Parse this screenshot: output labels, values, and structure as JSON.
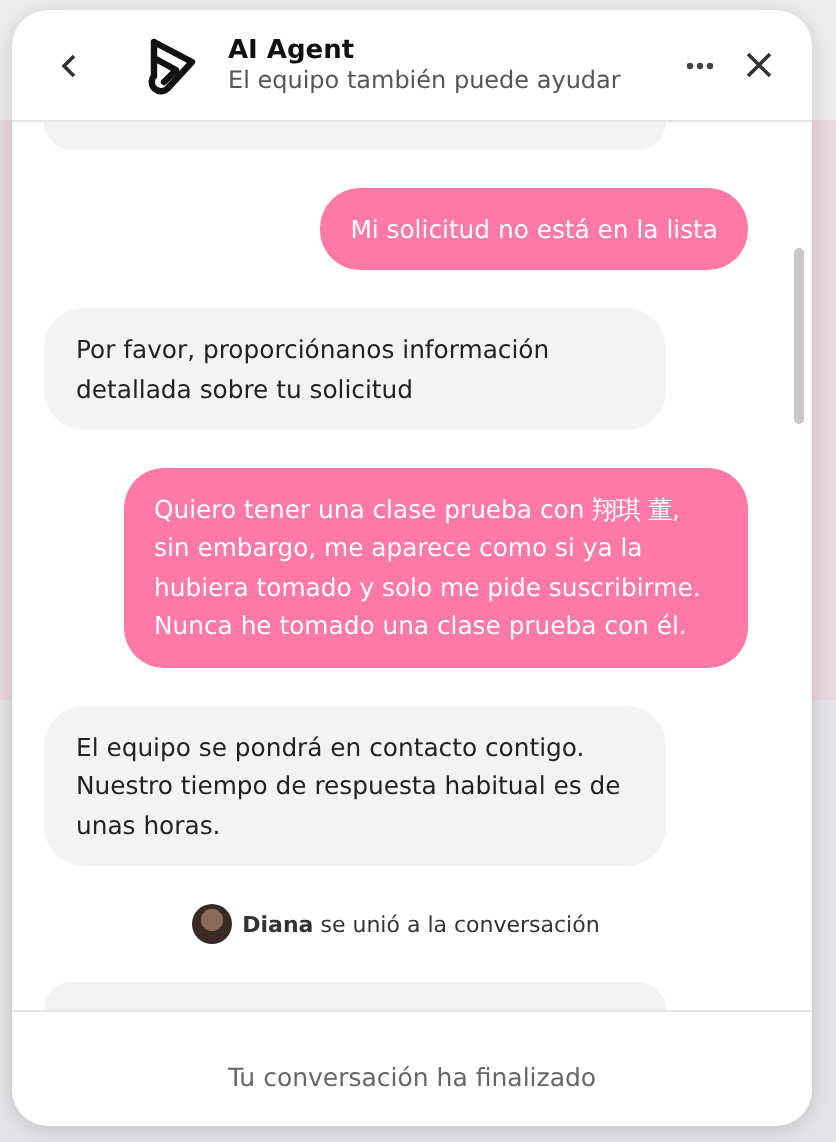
{
  "header": {
    "title": "AI Agent",
    "subtitle": "El equipo también puede ayudar"
  },
  "messages": [
    {
      "kind": "clipped",
      "outgoing": false
    },
    {
      "kind": "text",
      "outgoing": true,
      "text": "Mi solicitud no está en la lista"
    },
    {
      "kind": "text",
      "outgoing": false,
      "text": "Por favor, proporciónanos información detallada sobre tu solicitud"
    },
    {
      "kind": "text",
      "outgoing": true,
      "text": "Quiero tener una clase prueba con 翔琪 董, sin embargo, me aparece como si ya la hubiera tomado y solo me pide suscribirme. Nunca he tomado una clase prueba con él."
    },
    {
      "kind": "text",
      "outgoing": false,
      "text": "El equipo se pondrá en contacto contigo. Nuestro tiempo de respuesta habitual es de unas horas."
    },
    {
      "kind": "event",
      "name": "Diana",
      "text": "se unió a la conversación"
    },
    {
      "kind": "clipped",
      "outgoing": false
    }
  ],
  "footer": "Tu conversación ha finalizado"
}
